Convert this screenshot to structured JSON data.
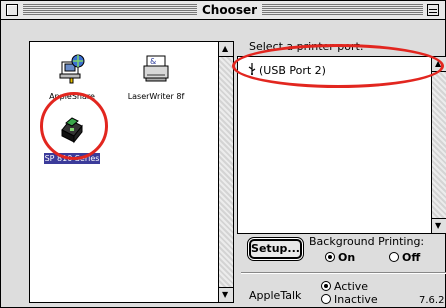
{
  "window": {
    "title": "Chooser"
  },
  "devices": [
    {
      "label": "AppleShare",
      "icon": "appleshare-icon"
    },
    {
      "label": "LaserWriter 8f",
      "icon": "laserwriter-icon"
    },
    {
      "label": "SP 810 Series",
      "icon": "printer-icon",
      "selected": true
    }
  ],
  "port": {
    "label": "Select a printer port:",
    "items": [
      "(USB Port 2)"
    ],
    "selected_index": 0
  },
  "setup": {
    "label": "Setup..."
  },
  "background_printing": {
    "label": "Background Printing:",
    "on_label": "On",
    "off_label": "Off",
    "selected": "On"
  },
  "appletalk": {
    "label": "AppleTalk",
    "active_label": "Active",
    "inactive_label": "Inactive",
    "selected": "Active"
  },
  "version": "7.6.2",
  "colors": {
    "highlight": "#e2261f",
    "selection": "#3b3b9a"
  }
}
